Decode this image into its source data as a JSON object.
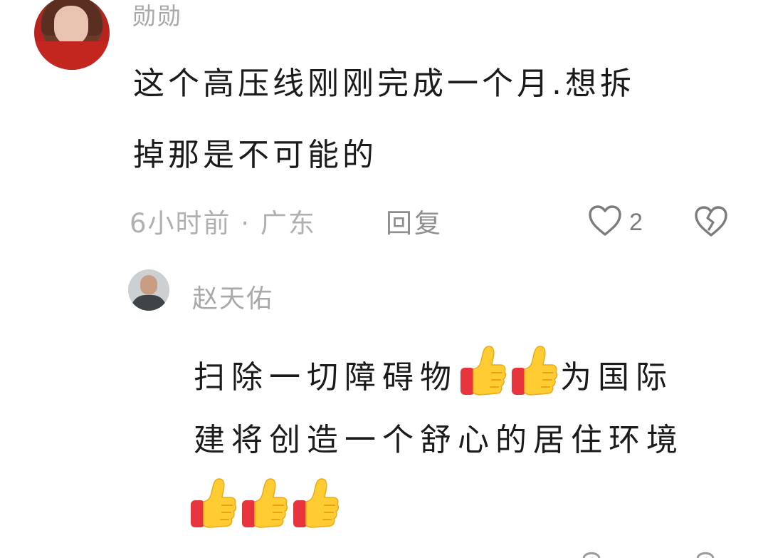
{
  "comment": {
    "username": "勋勋",
    "content_lines": [
      "这个高压线刚刚完成一个月.想拆",
      "掉那是不可能的"
    ],
    "time_location": "6小时前 · 广东",
    "reply_label": "回复",
    "like_count": "2"
  },
  "reply": {
    "username": "赵天佑",
    "content_line1_before": "扫除一切障碍物",
    "content_line1_after": "为国际",
    "content_line2": "建将创造一个舒心的居住环境"
  },
  "icons": {
    "like": "heart-outline-icon",
    "dislike": "broken-heart-icon",
    "emoji": "thumbs-up-emoji"
  },
  "colors": {
    "text": "#1b1b1b",
    "username": "#a9a9a9",
    "meta": "#b0b0b0",
    "thumb_yellow": "#ffcc33",
    "thumb_red": "#e8343d"
  }
}
